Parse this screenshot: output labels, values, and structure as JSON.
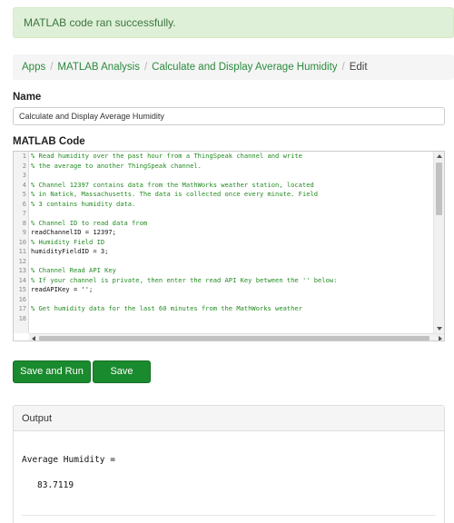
{
  "alert": {
    "message": "MATLAB code ran successfully."
  },
  "breadcrumb": {
    "items": [
      "Apps",
      "MATLAB Analysis",
      "Calculate and Display Average Humidity"
    ],
    "current": "Edit"
  },
  "name_field": {
    "label": "Name",
    "value": "Calculate and Display Average Humidity"
  },
  "code_editor": {
    "label": "MATLAB Code",
    "lines": [
      {
        "n": "1",
        "text": "% Read humidity over the past hour from a ThingSpeak channel and write",
        "kind": "comment"
      },
      {
        "n": "2",
        "text": "% the average to another ThingSpeak channel.",
        "kind": "comment"
      },
      {
        "n": "3",
        "text": "",
        "kind": "blank"
      },
      {
        "n": "4",
        "text": "% Channel 12397 contains data from the MathWorks weather station, located",
        "kind": "comment"
      },
      {
        "n": "5",
        "text": "% in Natick, Massachusetts. The data is collected once every minute. Field",
        "kind": "comment"
      },
      {
        "n": "6",
        "text": "% 3 contains humidity data.",
        "kind": "comment"
      },
      {
        "n": "7",
        "text": "",
        "kind": "blank"
      },
      {
        "n": "8",
        "text": "% Channel ID to read data from",
        "kind": "comment"
      },
      {
        "n": "9",
        "text": "readChannelID = 12397;",
        "kind": "code"
      },
      {
        "n": "10",
        "text": "% Humidity Field ID",
        "kind": "comment"
      },
      {
        "n": "11",
        "text": "humidityFieldID = 3;",
        "kind": "code"
      },
      {
        "n": "12",
        "text": "",
        "kind": "blank"
      },
      {
        "n": "13",
        "text": "% Channel Read API Key",
        "kind": "comment"
      },
      {
        "n": "14",
        "text": "% If your channel is private, then enter the read API Key between the '' below:",
        "kind": "comment"
      },
      {
        "n": "15",
        "text": "readAPIKey = '';",
        "kind": "code"
      },
      {
        "n": "16",
        "text": "",
        "kind": "blank"
      },
      {
        "n": "17",
        "text": "% Get humidity data for the last 60 minutes from the MathWorks weather",
        "kind": "comment"
      },
      {
        "n": "18",
        "text": "",
        "kind": "blank"
      }
    ]
  },
  "buttons": {
    "save_and_run": "Save and Run",
    "save": "Save"
  },
  "output": {
    "title": "Output",
    "result_label": "Average Humidity =",
    "result_value": "83.7119"
  },
  "colors": {
    "alert_bg": "#dff0d8",
    "alert_text": "#3c763d",
    "link": "#2a8a3e",
    "button": "#1a8a2e",
    "comment": "#228b22"
  },
  "icons": {
    "scroll_up": "triangle-up-icon",
    "scroll_down": "triangle-down-icon",
    "scroll_left": "triangle-left-icon",
    "scroll_right": "triangle-right-icon"
  }
}
